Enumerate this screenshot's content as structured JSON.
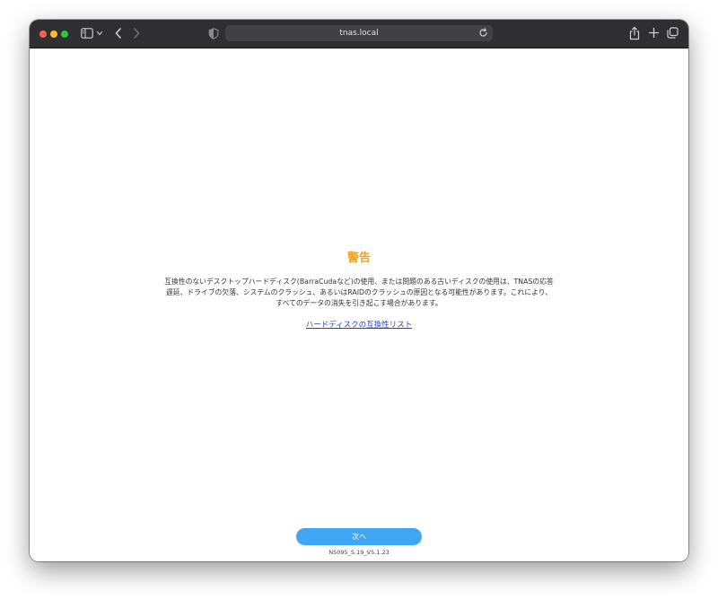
{
  "browser": {
    "url": "tnas.local",
    "icons": {
      "sidebar": "sidebar-icon",
      "dropdown": "chevron-down-icon",
      "back": "back-icon",
      "forward": "forward-icon",
      "privacy": "shield-icon",
      "reload": "reload-icon",
      "share": "share-icon",
      "new_tab": "plus-icon",
      "tabs": "tabs-overview-icon"
    }
  },
  "warning": {
    "title": "警告",
    "body_lines": [
      "互換性のないデスクトップハードディスク(BarraCudaなど)の使用、または問題のある古いディスクの使用は、TNASの応答",
      "遅延、ドライブの欠落、システムのクラッシュ、あるいはRAIDのクラッシュの原因となる可能性があります。これにより、",
      "すべてのデータの消失を引き起こす場合があります。"
    ],
    "link_text": "ハードディスクの互換性リスト"
  },
  "footer": {
    "next_label": "次へ",
    "version": "N5095_S.19_V5.1.23"
  },
  "colors": {
    "title": "#f4a31a",
    "link": "#2a42c8",
    "button": "#3fa6f5",
    "toolbar": "#2f2f31"
  }
}
